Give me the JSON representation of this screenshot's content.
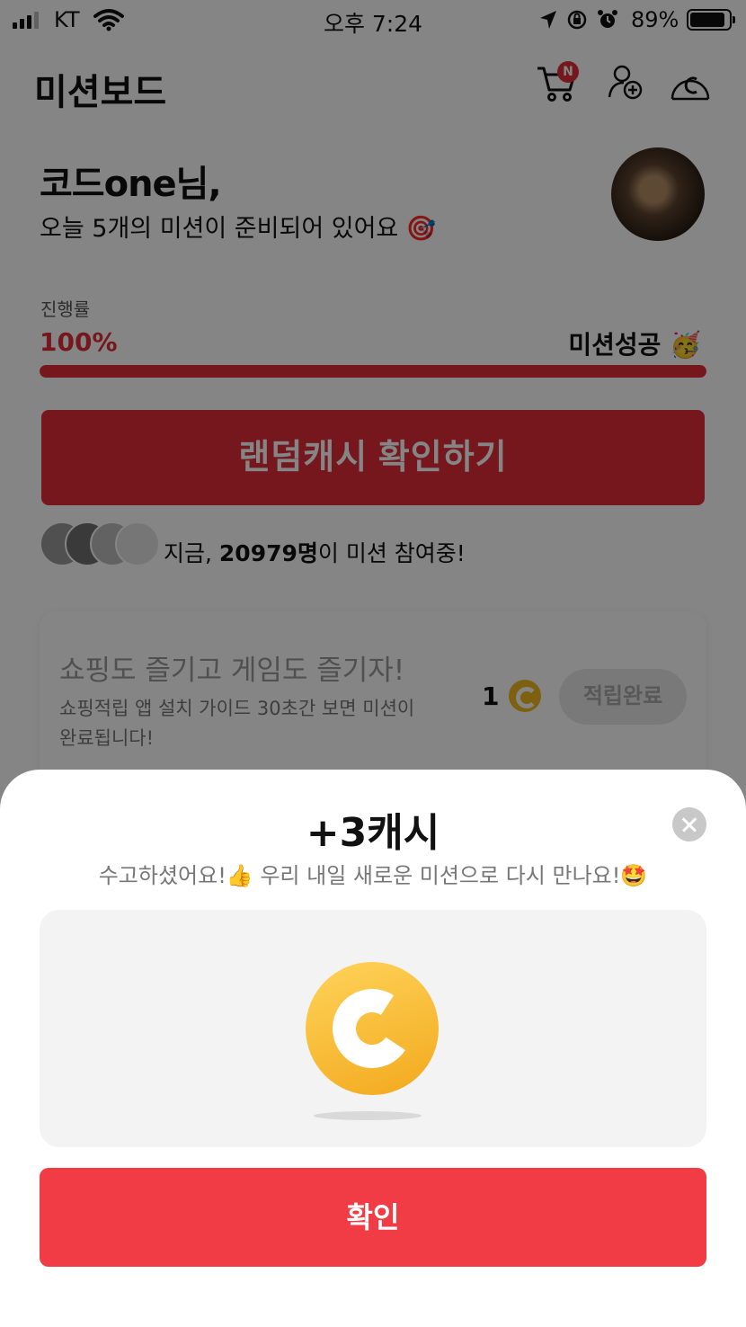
{
  "status_bar": {
    "carrier": "KT",
    "time": "오후 7:24",
    "battery": "89%"
  },
  "header": {
    "title": "미션보드",
    "cart_badge": "N"
  },
  "greeting": {
    "name": "코드one님,",
    "subtitle": "오늘 5개의 미션이 준비되어 있어요 🎯"
  },
  "progress": {
    "label": "진행률",
    "value_text": "100%",
    "value": 1.0,
    "status": "미션성공 🥳"
  },
  "random_cash_button": "랜덤캐시 확인하기",
  "participants": {
    "prefix": "지금, ",
    "count": "20979명",
    "suffix": "이 미션 참여중!"
  },
  "mission_card": {
    "title": "쇼핑도 즐기고 게임도 즐기자!",
    "description": "쇼핑적립 앱 설치 가이드 30초간 보면 미션이 완료됩니다!",
    "reward": "1",
    "button": "적립완료"
  },
  "popup": {
    "title": "+3캐시",
    "message": "수고하셨어요!👍 우리 내일 새로운 미션으로 다시 만나요!🤩",
    "confirm": "확인"
  },
  "colors": {
    "accent": "#e32d3a",
    "confirm": "#f23c45",
    "coin": "#f0b81f"
  }
}
